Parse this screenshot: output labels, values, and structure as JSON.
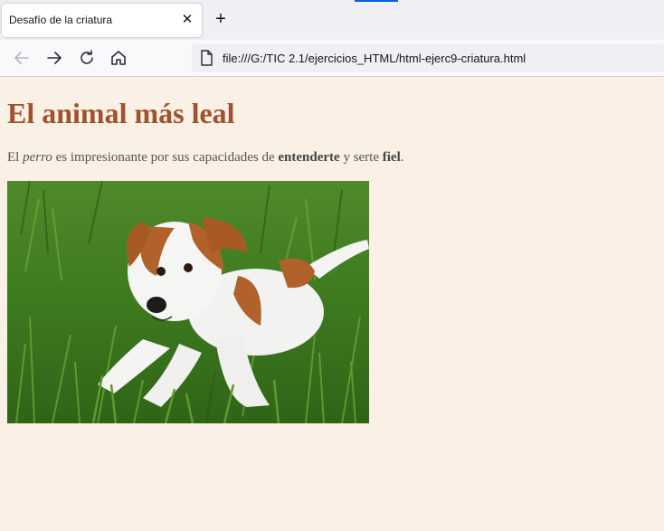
{
  "browser": {
    "tab_title": "Desafío de la criatura",
    "tab_close": "✕",
    "new_tab": "+",
    "url": "file:///G:/TIC 2.1/ejercicios_HTML/html-ejerc9-criatura.html"
  },
  "page": {
    "title": "El animal más leal",
    "paragraph": {
      "t1": "El ",
      "em": "perro",
      "t2": " es impresionante por sus capacidades de ",
      "strong1": "entenderte",
      "t3": " y serte ",
      "strong2": "fiel",
      "t4": "."
    },
    "image_subject": "puppy lying on grass"
  },
  "colors": {
    "page_background": "#faf0e6",
    "heading": "#a0522d",
    "text": "#555555"
  },
  "icons": [
    "back-arrow-icon",
    "forward-arrow-icon",
    "reload-icon",
    "home-icon",
    "page-icon"
  ]
}
